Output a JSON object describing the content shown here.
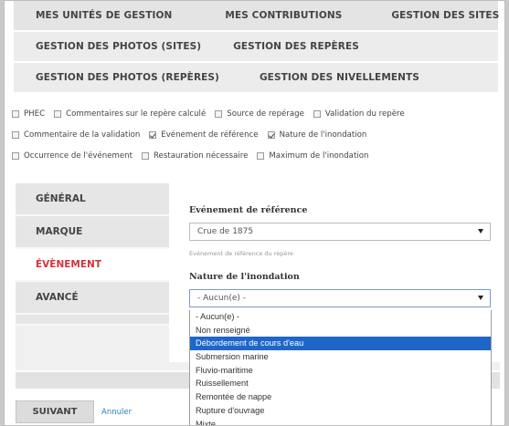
{
  "nav": {
    "row1": [
      "MES UNITÉS DE GESTION",
      "MES CONTRIBUTIONS",
      "GESTION DES SITES"
    ],
    "row2": [
      "GESTION DES PHOTOS (SITES)",
      "GESTION DES REPÈRES"
    ],
    "row3": [
      "GESTION DES PHOTOS (REPÈRES)",
      "GESTION DES NIVELLEMENTS"
    ]
  },
  "options": {
    "phec": {
      "label": "PHEC",
      "checked": false
    },
    "commentaires": {
      "label": "Commentaires sur le repère calculé",
      "checked": false
    },
    "source": {
      "label": "Source de repérage",
      "checked": false
    },
    "validation": {
      "label": "Validation du repère",
      "checked": false
    },
    "commentaire_validation": {
      "label": "Commentaire de la validation",
      "checked": false
    },
    "evenement_reference": {
      "label": "Evénement de référence",
      "checked": true
    },
    "nature_inondation": {
      "label": "Nature de l'inondation",
      "checked": true
    },
    "occurrence": {
      "label": "Occurrence de l'événement",
      "checked": false
    },
    "restauration": {
      "label": "Restauration nécessaire",
      "checked": false
    },
    "maximum": {
      "label": "Maximum de l'inondation",
      "checked": false
    }
  },
  "tabs": [
    {
      "label": "GÉNÉRAL",
      "active": false
    },
    {
      "label": "MARQUE",
      "active": false
    },
    {
      "label": "ÉVÈNEMENT",
      "active": true
    },
    {
      "label": "AVANCÉ",
      "active": false
    }
  ],
  "form": {
    "event_ref_label": "Evénement de référence",
    "event_ref_value": "Crue de 1875",
    "event_ref_help": "Evénement de référence du repère",
    "nature_label": "Nature de l'inondation",
    "nature_value": "- Aucun(e) -"
  },
  "dropdown": {
    "options": [
      "- Aucun(e) -",
      "Non renseigné",
      "Débordement de cours d'eau",
      "Submersion marine",
      "Fluvio-maritime",
      "Ruissellement",
      "Remontée de nappe",
      "Rupture d'ouvrage",
      "Mixte"
    ],
    "highlighted": "Débordement de cours d'eau"
  },
  "actions": {
    "next_label": "SUIVANT",
    "cancel_label": "Annuler"
  },
  "colors": {
    "active_tab": "#d0343c",
    "dropdown_highlight": "#1e67c9",
    "link": "#2a7fbf"
  }
}
